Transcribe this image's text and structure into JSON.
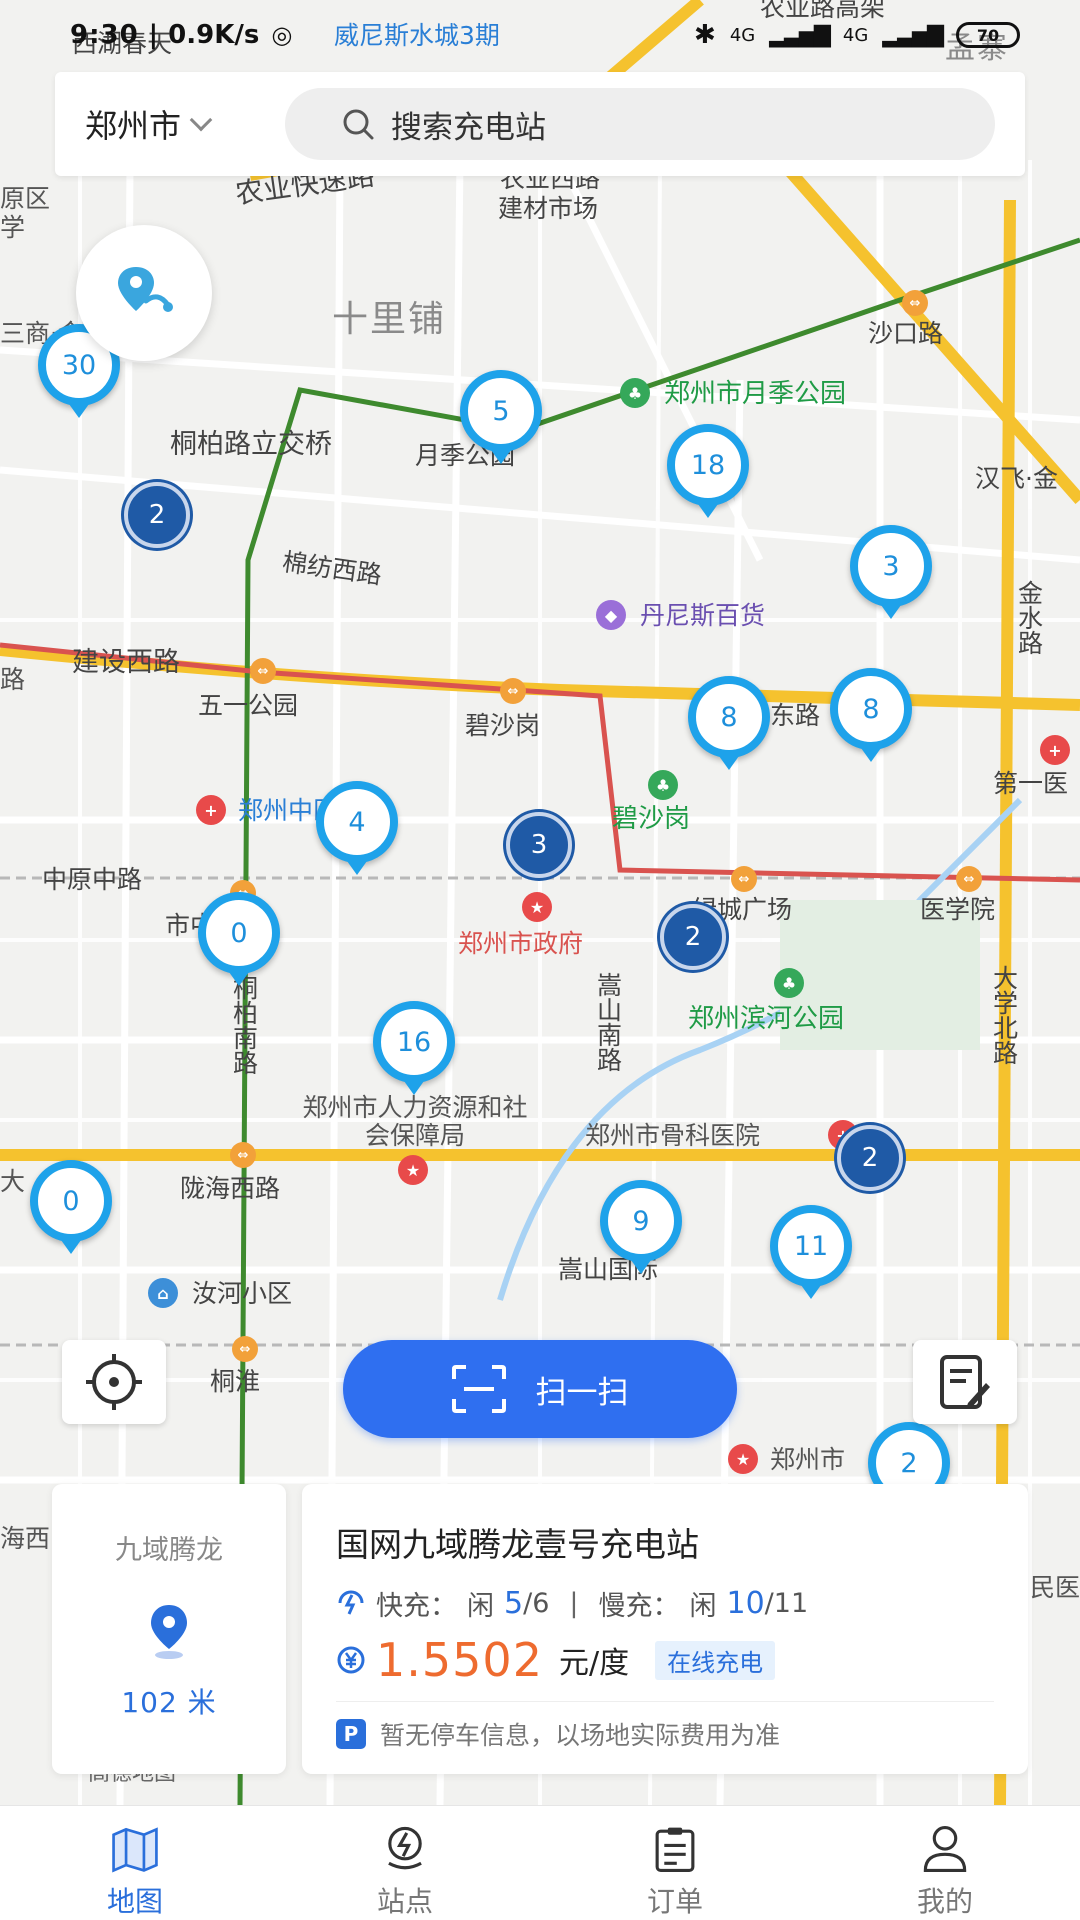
{
  "status_bar": {
    "time": "9:30",
    "net_speed": "0.9K/s",
    "network": "4G",
    "battery": "70"
  },
  "header": {
    "city": "郑州市",
    "search_placeholder": "搜索充电站"
  },
  "map": {
    "labels": {
      "hu_chun": "西湖春天",
      "weinisi": "威尼斯水城3期",
      "nongye_gao": "农业路高架",
      "mengzhai": "孟寨",
      "nongye_expy": "农业快速路",
      "nongye_west": "农业西路",
      "jiancai": "建材市场",
      "shilipu": "十里铺",
      "shakou": "沙口路",
      "yuejigongyuan_park": "郑州市月季公园",
      "tongbai_bridge": "桐柏路立交桥",
      "yuejigongyuan": "月季公园",
      "hanfei": "汉飞·金",
      "mianfang": "棉纺西路",
      "dannis": "丹尼斯百货",
      "jinshui": "金水路",
      "jianshe": "建设西路",
      "wuyi": "五一公园",
      "bishagang": "碧沙岗",
      "east_road": "东路",
      "first_hospital": "第一医",
      "hospital_zz": "郑州中医院",
      "bishagang_park": "碧沙岗",
      "zhongyuan": "中原中路",
      "lvcheng": "绿城广场",
      "yixueyuan": "医学院",
      "shi_hospital": "市中医院",
      "gov": "郑州市政府",
      "tongbai_south": "桐柏南路",
      "songshan_south": "嵩山南路",
      "binhe_park": "郑州滨河公园",
      "daxue_north": "大学北路",
      "renli": "郑州市人力资源和社会保障局",
      "guke": "郑州市骨科医院",
      "longhai": "陇海西路",
      "ruhe": "汝河小区",
      "songshan_intl": "嵩山国际",
      "tonghuai": "桐淮",
      "bottom_poi": "郑州市",
      "yuan_fragment": "原区",
      "xue_fragment": "学",
      "da_fragment": "大",
      "hai_fragment": "海西",
      "min_fragment": "民医",
      "shang_fragment": "三商·金城",
      "lu_fragment": "路",
      "brand": "高德地图"
    },
    "chargers": [
      {
        "count": "30"
      },
      {
        "count": "5"
      },
      {
        "count": "18"
      },
      {
        "count": "3"
      },
      {
        "count": "8"
      },
      {
        "count": "8"
      },
      {
        "count": "4"
      },
      {
        "count": "0"
      },
      {
        "count": "16"
      },
      {
        "count": "0"
      },
      {
        "count": "9"
      },
      {
        "count": "11"
      },
      {
        "count": "2"
      }
    ],
    "clusters": [
      {
        "count": "2"
      },
      {
        "count": "3"
      },
      {
        "count": "2"
      },
      {
        "count": "2"
      }
    ]
  },
  "scan_button": "扫一扫",
  "station": {
    "short_name": "九域腾龙",
    "distance": "102 米",
    "name": "国网九域腾龙壹号充电站",
    "fast_label": "快充：",
    "idle_label": "闲",
    "fast_free": "5",
    "fast_total": "/6",
    "slow_label": "慢充：",
    "slow_free": "10",
    "slow_total": "/11",
    "separator": "|",
    "price": "1.5502",
    "unit": "元/度",
    "tag": "在线充电",
    "parking_badge": "P",
    "parking": "暂无停车信息，以场地实际费用为准"
  },
  "bottom_nav": [
    {
      "label": "地图",
      "icon": "map-icon",
      "active": true
    },
    {
      "label": "站点",
      "icon": "station-icon",
      "active": false
    },
    {
      "label": "订单",
      "icon": "order-icon",
      "active": false
    },
    {
      "label": "我的",
      "icon": "profile-icon",
      "active": false
    }
  ],
  "colors": {
    "accent": "#2f6ff0",
    "pin_blue": "#1ea2ea",
    "cluster_blue": "#1f5aa6",
    "price_orange": "#ee6b2f",
    "road_yellow": "#f5c22e",
    "metro_green": "#3e8a2e",
    "metro_red": "#d9534f"
  }
}
